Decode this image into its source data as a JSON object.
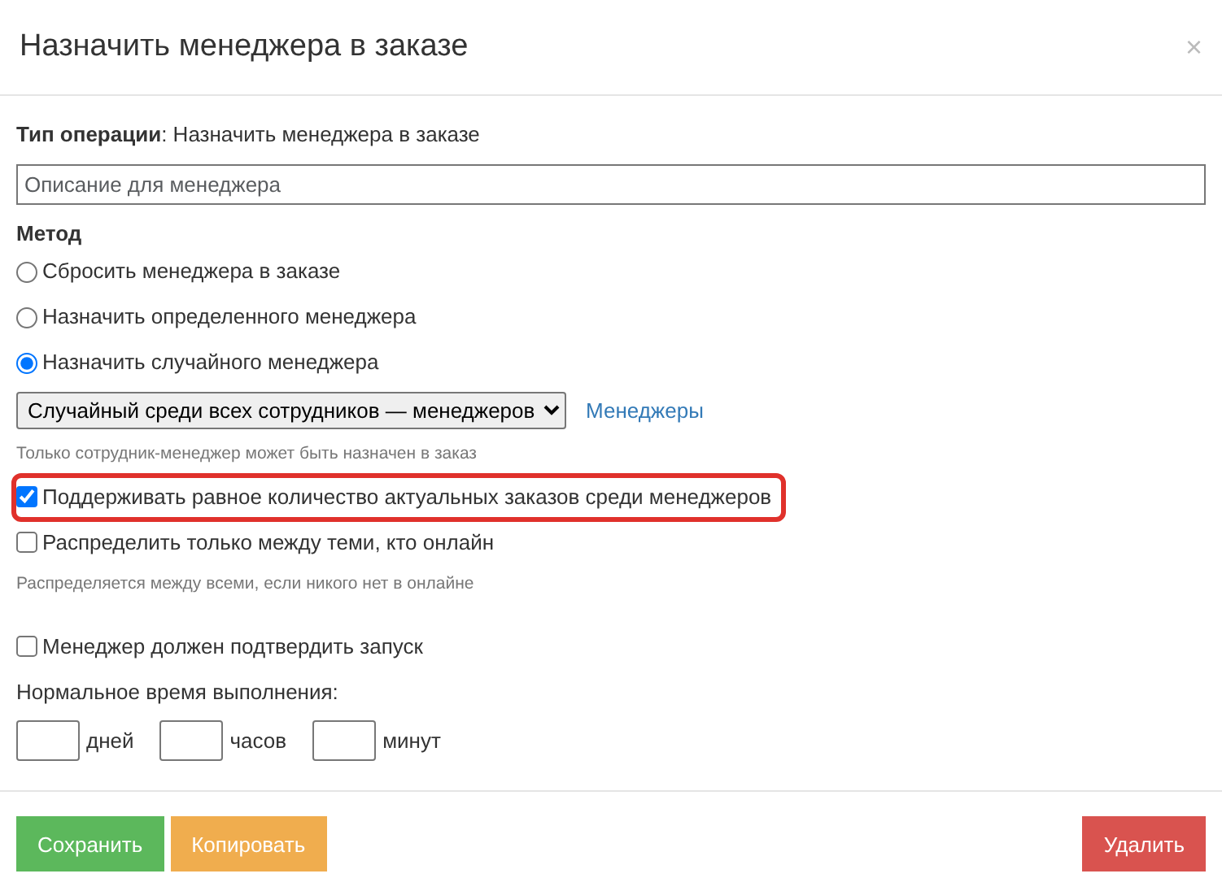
{
  "modal": {
    "title": "Назначить менеджера в заказе",
    "close": "×"
  },
  "operation": {
    "text": "**Тип операции**: Назначить менеджера в заказе"
  },
  "description": {
    "placeholder": "Описание для менеджера"
  },
  "method": {
    "label": "Метод",
    "options": [
      {
        "label": "Сбросить менеджера в заказе",
        "selected": false
      },
      {
        "label": "Назначить определенного менеджера",
        "selected": false
      },
      {
        "label": "Назначить случайного менеджера",
        "selected": true
      }
    ]
  },
  "random_select": {
    "value": "Случайный среди всех сотрудников — менеджеров",
    "link": "Менеджеры",
    "hint": "Только сотрудник-менеджер может быть назначен в заказ"
  },
  "options": [
    {
      "label": "Поддерживать равное количество актуальных заказов среди менеджеров",
      "checked": true,
      "highlighted": true
    },
    {
      "label": "Распределить только между теми, кто онлайн",
      "checked": false,
      "highlighted": false,
      "hint": "Распределяется между всеми, если никого нет в онлайне"
    },
    {
      "label": "Менеджер должен подтвердить запуск",
      "checked": false,
      "highlighted": false
    }
  ],
  "duration": {
    "label": "Нормальное время выполнения:",
    "units": [
      "дней",
      "часов",
      "минут"
    ]
  },
  "buttons": [
    {
      "label": "Сохранить",
      "kind": "save"
    },
    {
      "label": "Копировать",
      "kind": "copy"
    },
    {
      "label": "Удалить",
      "kind": "delete"
    }
  ]
}
